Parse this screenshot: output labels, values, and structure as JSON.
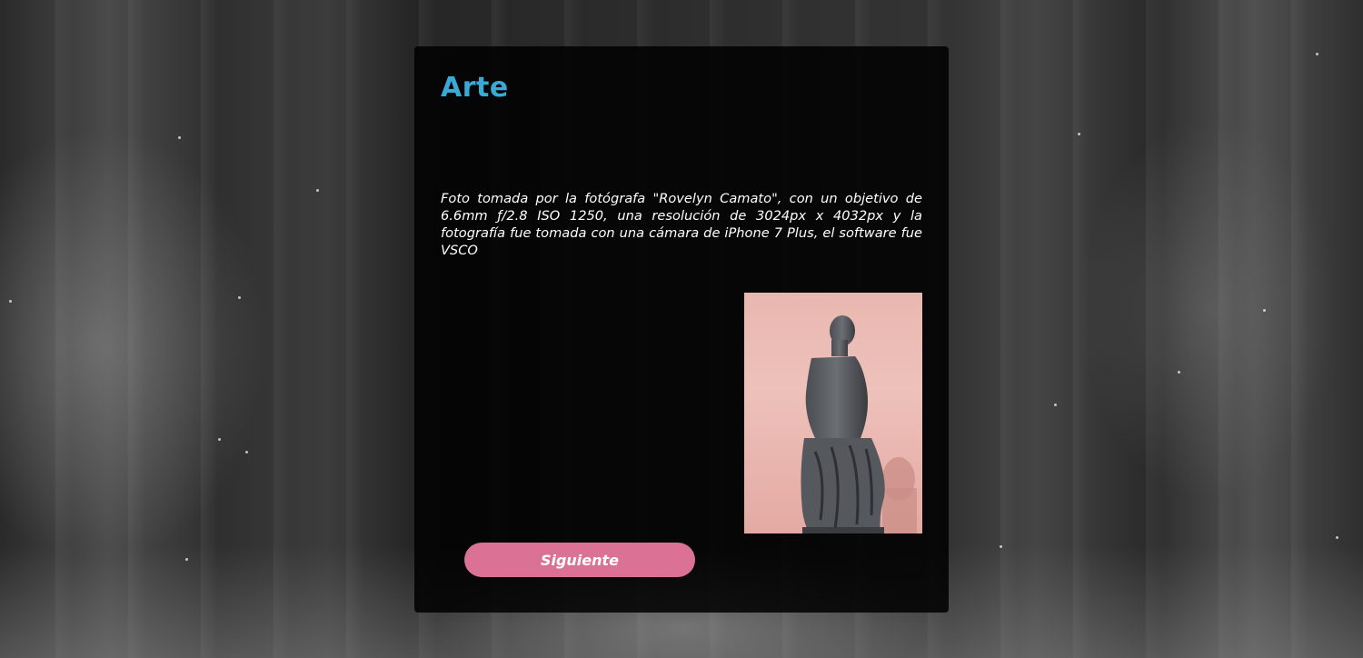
{
  "card": {
    "title": "Arte",
    "description": "Foto tomada por la fotógrafa \"Rovelyn Camato\", con un objetivo de 6.6mm ƒ/2.8 ISO 1250, una resolución de 3024px x 4032px y la fotografía fue tomada con una cámara de iPhone 7 Plus, el software fue VSCO",
    "image_icon": "statue-photo",
    "next_label": "Siguiente"
  },
  "colors": {
    "title": "#3ba9d6",
    "button": "#dc7196",
    "card_bg": "#000000"
  }
}
